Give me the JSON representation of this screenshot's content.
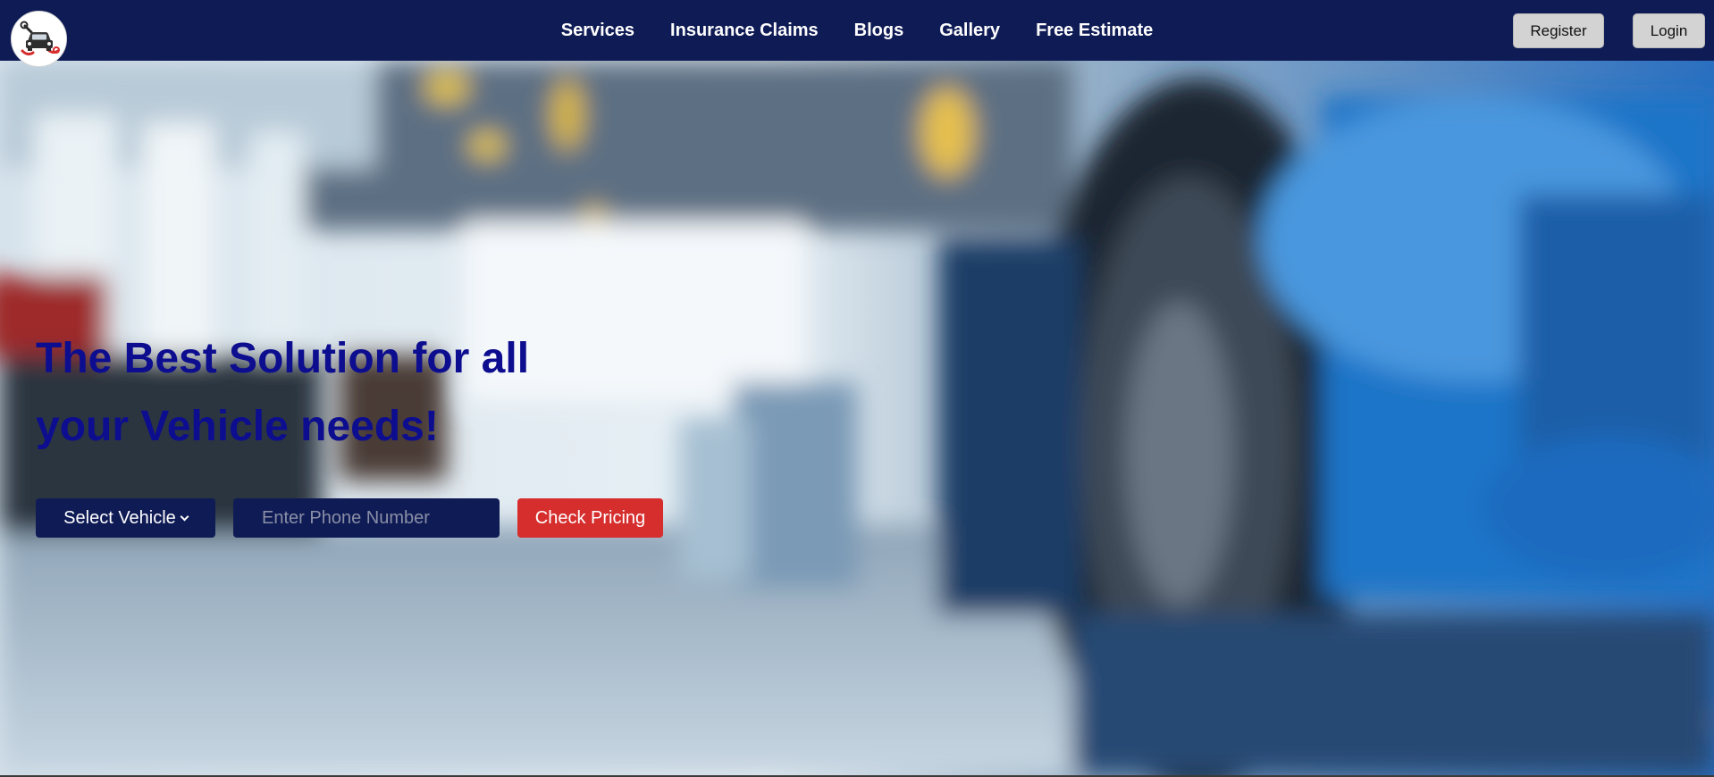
{
  "nav": {
    "logo_icon": "car-repair-logo-icon",
    "links": [
      "Services",
      "Insurance Claims",
      "Blogs",
      "Gallery",
      "Free Estimate"
    ],
    "register_label": "Register",
    "login_label": "Login"
  },
  "hero": {
    "headline_line1": "The Best Solution for all",
    "headline_line2": "your Vehicle needs!",
    "select_vehicle_label": "Select Vehicle",
    "phone_placeholder": "Enter Phone Number",
    "check_pricing_label": "Check Pricing",
    "background_image": "blurred-car-showroom-with-blue-sports-car"
  },
  "colors": {
    "navbar": "#0f1b55",
    "headline": "#0d0d8f",
    "cta": "#d62d2d",
    "auth_button": "#d3d3d3"
  }
}
